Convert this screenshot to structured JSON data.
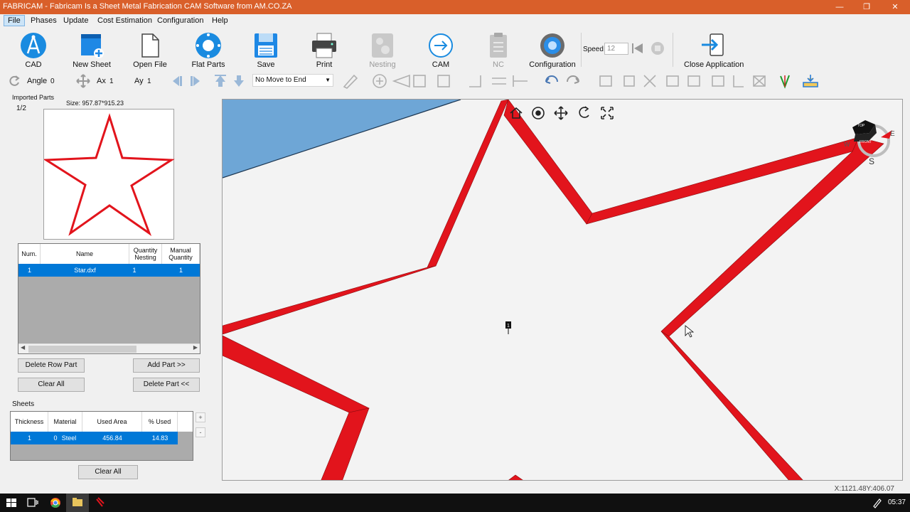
{
  "window": {
    "title": "FABRICAM - Fabricam Is a Sheet Metal Fabrication CAM Software from AM.CO.ZA",
    "minimize": "—",
    "restore": "❐",
    "close": "✕"
  },
  "menu": [
    "File",
    "Phases",
    "Update",
    "Cost Estimation",
    "Configuration",
    "Help"
  ],
  "toolbar": {
    "cad": "CAD",
    "new_sheet": "New Sheet",
    "open_file": "Open File",
    "flat_parts": "Flat Parts",
    "save": "Save",
    "print": "Print",
    "nesting": "Nesting",
    "cam": "CAM",
    "nc": "NC",
    "configuration": "Configuration",
    "speed_label": "Speed",
    "speed_value": "12",
    "close_application": "Close Application"
  },
  "toolbar2": {
    "angle_label": "Angle",
    "angle_value": "0",
    "ax_label": "Ax",
    "ax_value": "1",
    "ay_label": "Ay",
    "ay_value": "1",
    "move_option": "No Move to End"
  },
  "imported_parts": {
    "title": "Imported Parts",
    "page": "1/2",
    "size": "Size: 957.87*915.23",
    "columns": [
      "Num.",
      "Name",
      "Quantity Nesting",
      "Manual Quantity"
    ],
    "rows": [
      {
        "num": "1",
        "name": "Star.dxf",
        "qty_nesting": "1",
        "manual_qty": "1"
      }
    ],
    "delete_row": "Delete Row Part",
    "add_part": "Add Part >>",
    "clear_all": "Clear All",
    "delete_part": "Delete Part <<"
  },
  "sheets": {
    "title": "Sheets",
    "columns": [
      "Thickness",
      "Material",
      "Used Area",
      "% Used"
    ],
    "rows": [
      {
        "thickness": "1",
        "material_index": "0",
        "material": "Steel",
        "used_area": "456.84",
        "used_pct": "14.83"
      }
    ],
    "plus": "+",
    "minus": "-",
    "clear_all": "Clear All"
  },
  "viewcube": {
    "top": "TOP",
    "front": "FRONT",
    "east": "E",
    "west": "W",
    "south": "S"
  },
  "canvas": {
    "marker": "1"
  },
  "status": {
    "coords": "X:1121.48Y:406.07"
  },
  "taskbar": {
    "time": "05:37"
  },
  "colors": {
    "titlebar": "#d95f2a",
    "selection": "#0078d7",
    "star": "#e2141c",
    "sheet": "#6ea6d6"
  }
}
